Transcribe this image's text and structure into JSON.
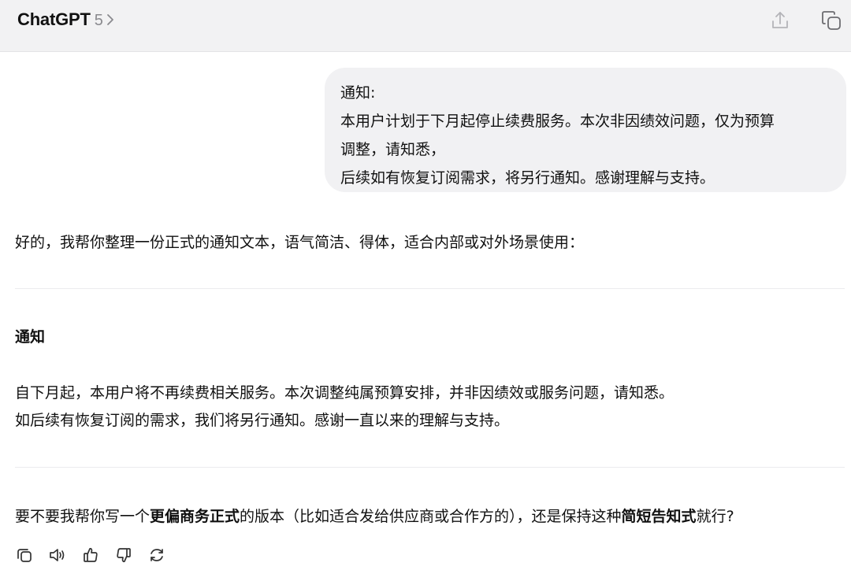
{
  "header": {
    "app_name": "ChatGPT",
    "model_version": "5",
    "icons": {
      "model_chevron": "chevron-right-icon",
      "share": "share-icon",
      "new_chat": "new-chat-icon"
    }
  },
  "conversation": {
    "user_message": {
      "lines": [
        "通知:",
        "本用户计划于下月起停止续费服务。本次非因绩效问题，仅为预算",
        "调整，请知悉，",
        "后续如有恢复订阅需求，将另行通知。感谢理解与支持。"
      ]
    },
    "assistant_message": {
      "intro": "好的，我帮你整理一份正式的通知文本，语气简洁、得体，适合内部或对外场景使用：",
      "notice_heading": "通知",
      "notice_lines": [
        "自下月起，本用户将不再续费相关服务。本次调整纯属预算安排，并非因绩效或服务问题，请知悉。",
        "如后续有恢复订阅的需求，我们将另行通知。感谢一直以来的理解与支持。"
      ],
      "followup": {
        "part1": "要不要我帮你写一个",
        "bold1": "更偏商务正式",
        "part2": "的版本（比如适合发给供应商或合作方的），还是保持这种",
        "bold2": "简短告知式",
        "part3": "就行?"
      }
    },
    "actions": {
      "copy": "copy-icon",
      "read_aloud": "read-aloud-icon",
      "thumbs_up": "thumbs-up-icon",
      "thumbs_down": "thumbs-down-icon",
      "regenerate": "regenerate-icon"
    }
  },
  "colors": {
    "header_bg": "#f2f2f3",
    "bubble_bg": "#f1f1f3",
    "text": "#111111",
    "muted": "#8a8a8e",
    "divider": "#ececee"
  }
}
